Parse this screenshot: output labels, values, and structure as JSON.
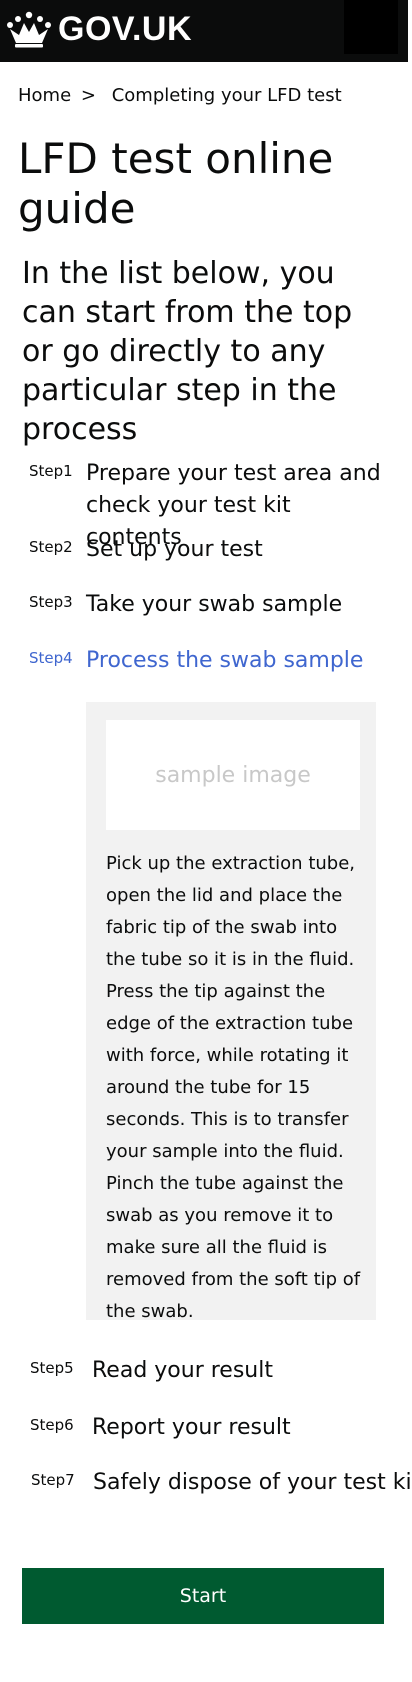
{
  "header": {
    "logo_text": "GOV.UK",
    "menu_icon": "menu-icon"
  },
  "breadcrumb": {
    "home": "Home",
    "separator": ">",
    "current": "Completing your LFD test"
  },
  "page_title": "LFD test online guide",
  "lead": "In the list below, you can start from the top or go directly to any particular step in the process",
  "steps": [
    {
      "number": "Step1",
      "title": "Prepare your test area and check your test kit contents"
    },
    {
      "number": "Step2",
      "title": "Set up your test"
    },
    {
      "number": "Step3",
      "title": "Take your swab sample"
    },
    {
      "number": "Step4",
      "title": "Process the swab sample",
      "active": true
    },
    {
      "number": "Step5",
      "title": "Read your result"
    },
    {
      "number": "Step6",
      "title": "Report your result"
    },
    {
      "number": "Step7",
      "title": "Safely dispose of your test kit"
    }
  ],
  "active_step_panel": {
    "image_placeholder": "sample image",
    "paragraphs": [
      "Pick up the extraction tube, open the lid and place the fabric tip of the swab into the tube so it is in the fluid.",
      "Press the tip against the edge of the extraction tube with force, while rotating it around the tube for 15 seconds. This is to transfer your sample into the fluid.",
      "Pinch the tube against the swab as you remove it to make sure all the fluid is removed from the soft tip of the swab."
    ]
  },
  "start_button": "Start",
  "colors": {
    "header_bg": "#0b0c0c",
    "active_step": "#3f66cf",
    "panel_bg": "#f2f2f2",
    "button_bg": "#005a30"
  }
}
